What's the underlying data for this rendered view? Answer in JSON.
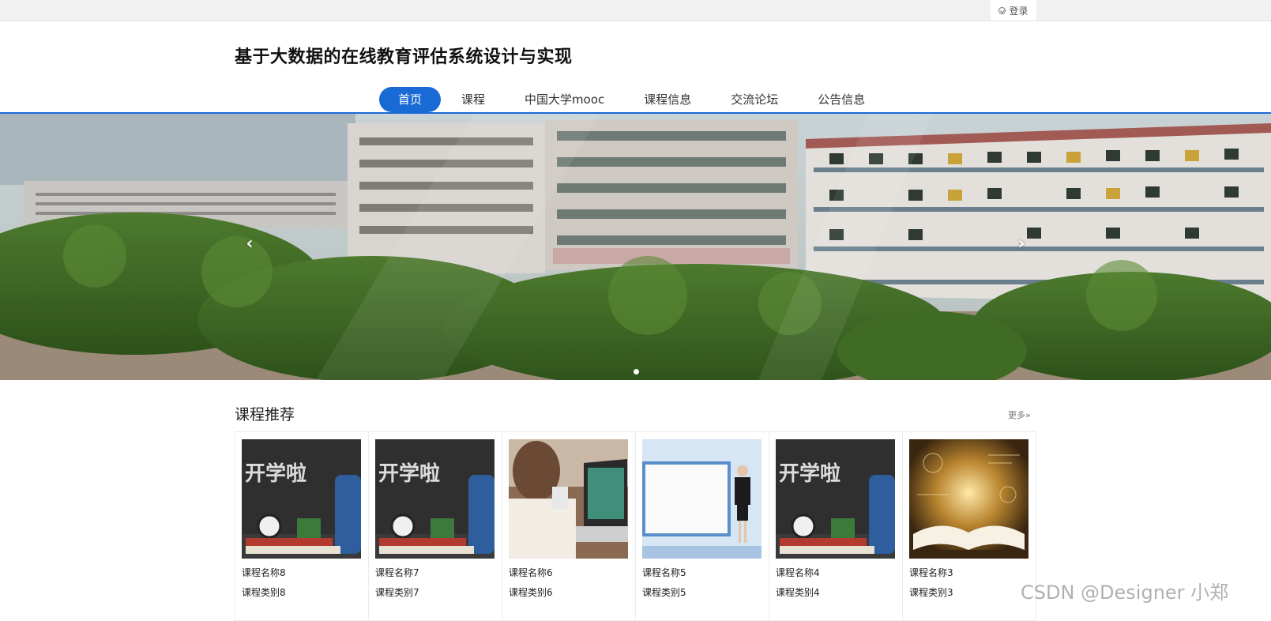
{
  "topbar": {
    "login_label": "登录"
  },
  "header": {
    "title": "基于大数据的在线教育评估系统设计与实现"
  },
  "nav": {
    "items": [
      {
        "label": "首页",
        "active": true
      },
      {
        "label": "课程",
        "active": false
      },
      {
        "label": "中国大学mooc",
        "active": false
      },
      {
        "label": "课程信息",
        "active": false
      },
      {
        "label": "交流论坛",
        "active": false
      },
      {
        "label": "公告信息",
        "active": false
      }
    ],
    "accent_color": "#1a6ad6"
  },
  "banner": {
    "prev_icon": "chevron-left-icon",
    "next_icon": "chevron-right-icon",
    "prev_glyph": "‹",
    "next_glyph": "›",
    "slides_count": 1,
    "active_slide": 1
  },
  "recommend": {
    "title": "课程推荐",
    "more_label": "更多»",
    "cards": [
      {
        "name": "课程名称8",
        "category": "课程类别8",
        "image": "chalkboard-backpack"
      },
      {
        "name": "课程名称7",
        "category": "课程类别7",
        "image": "chalkboard-backpack"
      },
      {
        "name": "课程名称6",
        "category": "课程类别6",
        "image": "student-laptop"
      },
      {
        "name": "课程名称5",
        "category": "课程类别5",
        "image": "presenter-screen"
      },
      {
        "name": "课程名称4",
        "category": "课程类别4",
        "image": "chalkboard-backpack"
      },
      {
        "name": "课程名称3",
        "category": "课程类别3",
        "image": "book-formulas"
      }
    ]
  },
  "watermark": "CSDN @Designer 小郑"
}
